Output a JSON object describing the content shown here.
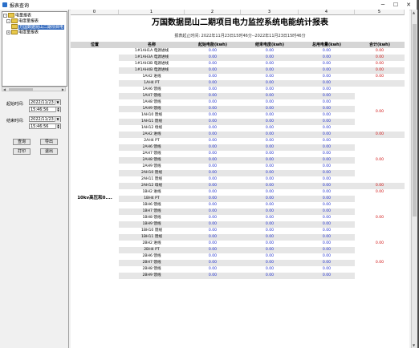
{
  "window": {
    "title": "报表查询"
  },
  "tree": {
    "root": "电量报表",
    "child1": "电度量报表",
    "child1_item": "万国数据昆山二期项目电",
    "child2": "电度量报表"
  },
  "form": {
    "start_label": "起始时间:",
    "start_date": "2022/11/23",
    "start_time": "15:46:56",
    "end_label": "结束时间:",
    "end_date": "2022/11/23",
    "end_time": "15:46:56",
    "btn_query": "查询",
    "btn_export": "导出",
    "btn_print": "打印",
    "btn_exit": "退出"
  },
  "grid": {
    "col_headers": [
      "0",
      "1",
      "2",
      "3",
      "4",
      "5"
    ]
  },
  "report": {
    "title": "万国数据昆山二期项目电力监控系统电能统计报表",
    "subtitle": "报表起止时间: 2022年11月23日15时46分--2022年11月23日15时46分",
    "headers": {
      "position": "位置",
      "name": "名称",
      "start": "起始电能(kwh)",
      "end": "结束电度(kwh)",
      "total": "总用电量(kwh)",
      "sum": "合计(kwh)"
    },
    "position_value": "10kv高压和0....",
    "rows": [
      {
        "name": "1#1AH1A 电源进线",
        "s": "0.00",
        "e": "0.00",
        "t": "0.00",
        "sum": "0.00"
      },
      {
        "name": "1#1AH3A 电源进线",
        "s": "0.00",
        "e": "0.00",
        "t": "0.00",
        "sum": "0.00"
      },
      {
        "name": "1#1AH3B 电源进线",
        "s": "0.00",
        "e": "0.00",
        "t": "0.00",
        "sum": "0.00"
      },
      {
        "name": "1#1AH4B 电源进线",
        "s": "0.00",
        "e": "0.00",
        "t": "0.00",
        "sum": "0.00"
      },
      {
        "name": "1AH2 进线",
        "s": "0.00",
        "e": "0.00",
        "t": "0.00",
        "sum": "0.00"
      },
      {
        "name": "1AH4 PT",
        "s": "0.00",
        "e": "0.00",
        "t": "0.00",
        "sum": ""
      },
      {
        "name": "1AH6 馈线",
        "s": "0.00",
        "e": "0.00",
        "t": "0.00",
        "sum": ""
      },
      {
        "name": "1AH7 馈线",
        "s": "0.00",
        "e": "0.00",
        "t": "0.00",
        "sum": ""
      },
      {
        "name": "1AH8 馈线",
        "s": "0.00",
        "e": "0.00",
        "t": "0.00",
        "sum": ""
      },
      {
        "name": "1AH9 馈线",
        "s": "0.00",
        "e": "0.00",
        "t": "0.00",
        "sum": ""
      },
      {
        "name": "1AH10 馈线",
        "s": "0.00",
        "e": "0.00",
        "t": "0.00",
        "sum": ""
      },
      {
        "name": "1AH11 馈线",
        "s": "0.00",
        "e": "0.00",
        "t": "0.00",
        "sum": ""
      },
      {
        "name": "1AH12 母线",
        "s": "0.00",
        "e": "0.00",
        "t": "0.00",
        "sum": "0.00"
      },
      {
        "name": "2AH2 进线",
        "s": "0.00",
        "e": "0.00",
        "t": "0.00",
        "sum": "0.00"
      },
      {
        "name": "2AH4 PT",
        "s": "0.00",
        "e": "0.00",
        "t": "0.00",
        "sum": ""
      },
      {
        "name": "2AH6 馈线",
        "s": "0.00",
        "e": "0.00",
        "t": "0.00",
        "sum": ""
      },
      {
        "name": "2AH7 馈线",
        "s": "0.00",
        "e": "0.00",
        "t": "0.00",
        "sum": ""
      },
      {
        "name": "2AH8 馈线",
        "s": "0.00",
        "e": "0.00",
        "t": "0.00",
        "sum": ""
      },
      {
        "name": "2AH9 馈线",
        "s": "0.00",
        "e": "0.00",
        "t": "0.00",
        "sum": ""
      },
      {
        "name": "2AH10 馈线",
        "s": "0.00",
        "e": "0.00",
        "t": "0.00",
        "sum": ""
      },
      {
        "name": "2AH11 馈线",
        "s": "0.00",
        "e": "0.00",
        "t": "0.00",
        "sum": ""
      },
      {
        "name": "2AH12 母线",
        "s": "0.00",
        "e": "0.00",
        "t": "0.00",
        "sum": "0.00"
      },
      {
        "name": "1BH2 进线",
        "s": "0.00",
        "e": "0.00",
        "t": "0.00",
        "sum": "0.00"
      },
      {
        "name": "1BH4 PT",
        "s": "0.00",
        "e": "0.00",
        "t": "0.00",
        "sum": ""
      },
      {
        "name": "1BH6 馈线",
        "s": "0.00",
        "e": "0.00",
        "t": "0.00",
        "sum": ""
      },
      {
        "name": "1BH7 馈线",
        "s": "0.00",
        "e": "0.00",
        "t": "0.00",
        "sum": ""
      },
      {
        "name": "1BH8 馈线",
        "s": "0.00",
        "e": "0.00",
        "t": "0.00",
        "sum": ""
      },
      {
        "name": "1BH9 馈线",
        "s": "0.00",
        "e": "0.00",
        "t": "0.00",
        "sum": ""
      },
      {
        "name": "1BH10 馈线",
        "s": "0.00",
        "e": "0.00",
        "t": "0.00",
        "sum": ""
      },
      {
        "name": "1BH11 馈线",
        "s": "0.00",
        "e": "0.00",
        "t": "0.00",
        "sum": ""
      },
      {
        "name": "2BH2 进线",
        "s": "0.00",
        "e": "0.00",
        "t": "0.00",
        "sum": "0.00"
      },
      {
        "name": "2BH4 PT",
        "s": "0.00",
        "e": "0.00",
        "t": "0.00",
        "sum": ""
      },
      {
        "name": "2BH6 馈线",
        "s": "0.00",
        "e": "0.00",
        "t": "0.00",
        "sum": ""
      },
      {
        "name": "2BH7 馈线",
        "s": "0.00",
        "e": "0.00",
        "t": "0.00",
        "sum": ""
      },
      {
        "name": "2BH8 馈线",
        "s": "0.00",
        "e": "0.00",
        "t": "0.00",
        "sum": ""
      },
      {
        "name": "2BH9 馈线",
        "s": "0.00",
        "e": "0.00",
        "t": "0.00",
        "sum": ""
      }
    ],
    "merged_sums": [
      "0.00",
      "0.00",
      "0.00",
      "0.00"
    ]
  }
}
